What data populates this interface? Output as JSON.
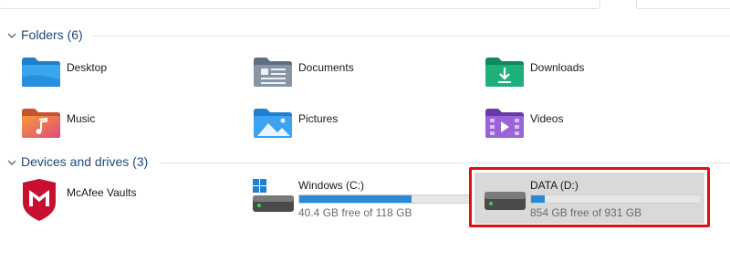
{
  "folders_group": {
    "title": "Folders (6)",
    "items": [
      {
        "label": "Desktop",
        "icon": "desktop-folder-icon"
      },
      {
        "label": "Documents",
        "icon": "documents-folder-icon"
      },
      {
        "label": "Downloads",
        "icon": "downloads-folder-icon"
      },
      {
        "label": "Music",
        "icon": "music-folder-icon"
      },
      {
        "label": "Pictures",
        "icon": "pictures-folder-icon"
      },
      {
        "label": "Videos",
        "icon": "videos-folder-icon"
      }
    ]
  },
  "devices_group": {
    "title": "Devices and drives (3)",
    "items": [
      {
        "label": "McAfee Vaults",
        "icon": "mcafee-icon"
      },
      {
        "label": "Windows (C:)",
        "icon": "windows-drive-icon",
        "free_text": "40.4 GB free of 118 GB",
        "used_fraction": 0.66
      },
      {
        "label": "DATA (D:)",
        "icon": "hard-drive-icon",
        "free_text": "854 GB free of 931 GB",
        "used_fraction": 0.08
      }
    ]
  },
  "colors": {
    "accent": "#2a8ad7",
    "header_text": "#1b4a7c",
    "highlight": "#e01010",
    "selection": "#d9d9d9"
  }
}
